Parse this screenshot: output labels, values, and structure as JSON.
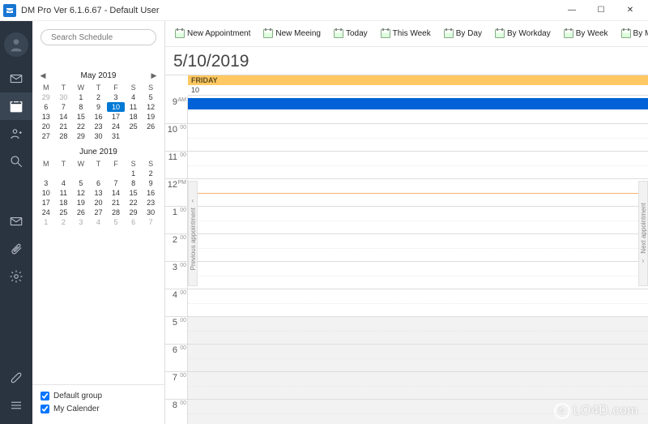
{
  "window": {
    "title": "DM Pro Ver 6.1.6.67  -  Default User"
  },
  "search": {
    "placeholder": "Search Schedule"
  },
  "toolbar": {
    "items": [
      "New Appointment",
      "New Meeing",
      "Today",
      "This Week",
      "By Day",
      "By Workday",
      "By Week",
      "By Month"
    ]
  },
  "dateTitle": "5/10/2019",
  "dayHeader": {
    "dayName": "FRIDAY",
    "dayNum": "10"
  },
  "miniCal1": {
    "title": "May 2019",
    "dow": [
      "M",
      "T",
      "W",
      "T",
      "F",
      "S",
      "S"
    ],
    "weeks": [
      [
        {
          "d": "29",
          "dim": true
        },
        {
          "d": "30",
          "dim": true
        },
        {
          "d": "1"
        },
        {
          "d": "2"
        },
        {
          "d": "3"
        },
        {
          "d": "4"
        },
        {
          "d": "5"
        }
      ],
      [
        {
          "d": "6"
        },
        {
          "d": "7"
        },
        {
          "d": "8"
        },
        {
          "d": "9"
        },
        {
          "d": "10",
          "sel": true
        },
        {
          "d": "11"
        },
        {
          "d": "12"
        }
      ],
      [
        {
          "d": "13"
        },
        {
          "d": "14"
        },
        {
          "d": "15"
        },
        {
          "d": "16"
        },
        {
          "d": "17"
        },
        {
          "d": "18"
        },
        {
          "d": "19"
        }
      ],
      [
        {
          "d": "20"
        },
        {
          "d": "21"
        },
        {
          "d": "22"
        },
        {
          "d": "23"
        },
        {
          "d": "24"
        },
        {
          "d": "25"
        },
        {
          "d": "26"
        }
      ],
      [
        {
          "d": "27"
        },
        {
          "d": "28"
        },
        {
          "d": "29"
        },
        {
          "d": "30"
        },
        {
          "d": "31"
        },
        {
          "d": ""
        },
        {
          "d": ""
        }
      ]
    ]
  },
  "miniCal2": {
    "title": "June 2019",
    "dow": [
      "M",
      "T",
      "W",
      "T",
      "F",
      "S",
      "S"
    ],
    "weeks": [
      [
        {
          "d": ""
        },
        {
          "d": ""
        },
        {
          "d": ""
        },
        {
          "d": ""
        },
        {
          "d": ""
        },
        {
          "d": "1"
        },
        {
          "d": "2"
        }
      ],
      [
        {
          "d": "3"
        },
        {
          "d": "4"
        },
        {
          "d": "5"
        },
        {
          "d": "6"
        },
        {
          "d": "7"
        },
        {
          "d": "8"
        },
        {
          "d": "9"
        }
      ],
      [
        {
          "d": "10"
        },
        {
          "d": "11"
        },
        {
          "d": "12"
        },
        {
          "d": "13"
        },
        {
          "d": "14"
        },
        {
          "d": "15"
        },
        {
          "d": "16"
        }
      ],
      [
        {
          "d": "17"
        },
        {
          "d": "18"
        },
        {
          "d": "19"
        },
        {
          "d": "20"
        },
        {
          "d": "21"
        },
        {
          "d": "22"
        },
        {
          "d": "23"
        }
      ],
      [
        {
          "d": "24"
        },
        {
          "d": "25"
        },
        {
          "d": "26"
        },
        {
          "d": "27"
        },
        {
          "d": "28"
        },
        {
          "d": "29"
        },
        {
          "d": "30"
        }
      ],
      [
        {
          "d": "1",
          "dim": true
        },
        {
          "d": "2",
          "dim": true
        },
        {
          "d": "3",
          "dim": true
        },
        {
          "d": "4",
          "dim": true
        },
        {
          "d": "5",
          "dim": true
        },
        {
          "d": "6",
          "dim": true
        },
        {
          "d": "7",
          "dim": true
        }
      ]
    ]
  },
  "groups": {
    "g1": "Default group",
    "g2": "My Calender"
  },
  "hours": [
    {
      "h": "9",
      "suffix": "AM",
      "nonwork": false
    },
    {
      "h": "10",
      "suffix": "00",
      "nonwork": false
    },
    {
      "h": "11",
      "suffix": "00",
      "nonwork": false
    },
    {
      "h": "12",
      "suffix": "PM",
      "nonwork": false,
      "hl": true
    },
    {
      "h": "1",
      "suffix": "00",
      "nonwork": false
    },
    {
      "h": "2",
      "suffix": "00",
      "nonwork": false
    },
    {
      "h": "3",
      "suffix": "00",
      "nonwork": false
    },
    {
      "h": "4",
      "suffix": "00",
      "nonwork": false
    },
    {
      "h": "5",
      "suffix": "00",
      "nonwork": true
    },
    {
      "h": "6",
      "suffix": "00",
      "nonwork": true
    },
    {
      "h": "7",
      "suffix": "00",
      "nonwork": true
    },
    {
      "h": "8",
      "suffix": "00",
      "nonwork": true
    }
  ],
  "sideTabs": {
    "prev": "Previous appointment",
    "next": "Next appointment"
  },
  "watermark": "LO4D.com"
}
